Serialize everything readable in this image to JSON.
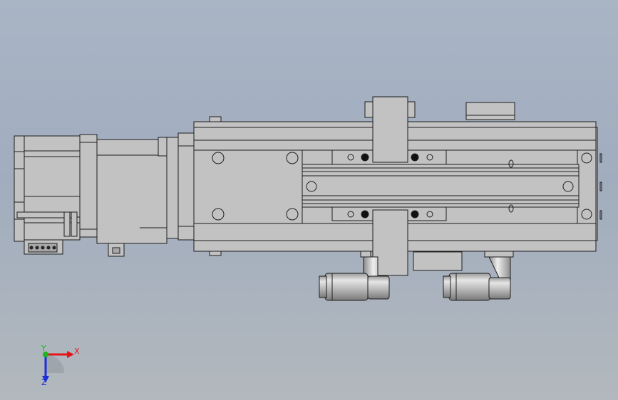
{
  "viewport": {
    "background_top": "#a9b5c5",
    "background_bottom": "#b2b8bd",
    "part_fill": "#c2c2c2",
    "part_stroke": "#1e1e1e",
    "fitting_fill": "#b9b9b9"
  },
  "triad": {
    "x_label": "X",
    "y_label": "Y",
    "z_label": "Z",
    "x_color": "#e8121b",
    "y_color": "#1fb51f",
    "z_color": "#1c2fd6"
  }
}
